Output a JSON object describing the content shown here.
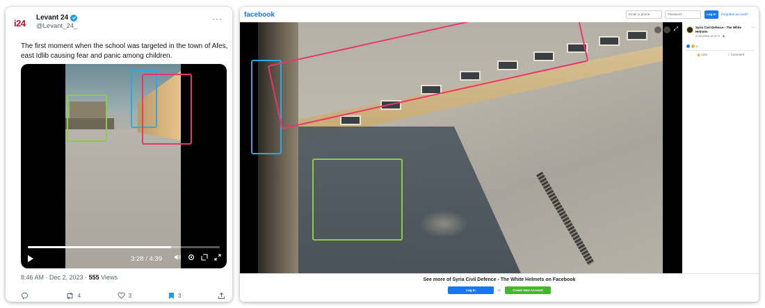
{
  "tweet": {
    "logo": "i24",
    "author_name": "Levant 24",
    "author_handle": "@Levant_24_",
    "more": "···",
    "text": "The first moment when the school was targeted in the town of Afes, east Idlib causing fear and panic among children.",
    "video": {
      "time": "3:28 / 4:39",
      "progress": 0.745
    },
    "meta": {
      "timestamp": "8:46 AM · Dec 2, 2023 · ",
      "views_count": "555",
      "views_label": " Views"
    },
    "actions": {
      "retweets": "4",
      "likes": "3",
      "bookmarks": "3"
    }
  },
  "facebook": {
    "logo": "facebook",
    "email_placeholder": "Email or phone",
    "password_placeholder": "Password",
    "login_small": "Log In",
    "forgot": "Forgotten account?",
    "page_name": "Syria Civil Defence - The White Helmets",
    "post_date": "2 December at 19:79 · ",
    "side_more": "···",
    "reaction_count": "3",
    "like_label": "Like",
    "comment_label": "Comment",
    "see_more": "See more of Syria Civil Defence - The White Helmets on Facebook",
    "login_button": "Log In",
    "or": "or",
    "create_account": "Create New Account"
  },
  "colors": {
    "box_green": "#8dcc46",
    "box_blue": "#2fa8e0",
    "box_pink": "#e9376d",
    "fb_blue": "#1877f2",
    "fb_green": "#42b72a",
    "twitter_blue": "#1d9bf0"
  }
}
